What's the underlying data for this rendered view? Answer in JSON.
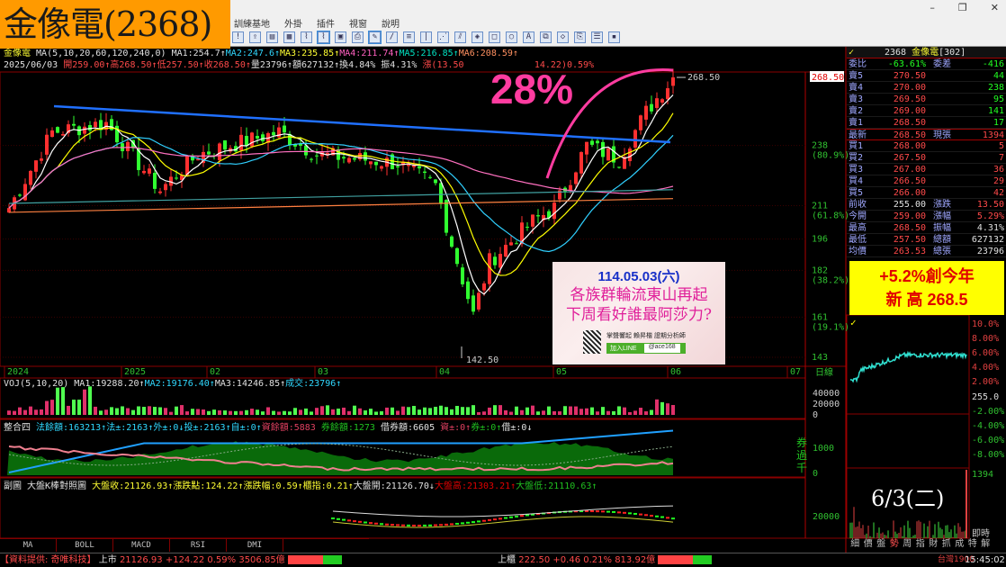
{
  "logo": "金像電(2368)",
  "menu": [
    "訓練基地",
    "外掛",
    "插件",
    "視窗",
    "說明"
  ],
  "toolbar_icons": [
    "alert-icon",
    "export-icon",
    "layout1-icon",
    "layout2-icon",
    "chart1-icon",
    "chart2-icon",
    "chart3-icon",
    "print-icon",
    "draw-icon",
    "line-icon",
    "fib-icon",
    "vlines-icon",
    "fan-icon",
    "channel-icon",
    "pattern-icon",
    "rect-icon",
    "circle-icon",
    "text-icon",
    "copy-icon",
    "eraser-icon",
    "snapshot-icon",
    "colors-icon",
    "save-icon"
  ],
  "info1": {
    "name": "金像電",
    "ma": "MA(5,10,20,60,120,240,0)",
    "ma1": "MA1:254.7↑",
    "ma2": "MA2:247.6↑",
    "ma3": "MA3:235.85↑",
    "ma4": "MA4:211.74↑",
    "ma5": "MA5:216.85↑",
    "ma6": "MA6:208.59↑"
  },
  "info2": {
    "date": "2025/06/03",
    "open": "開259.00↑",
    "high": "高268.50↑",
    "low": "低257.50↑",
    "close": "收268.50↑",
    "vol": "量23796↑",
    "amt": "額627132↑",
    "turn": "換4.84%",
    "amp": "振4.31%",
    "chg": "漲(13.50",
    "chg2": "14.22)0.59%"
  },
  "annotation": "28%",
  "price_axis": [
    {
      "v": "238",
      "p": "(80.9%)"
    },
    {
      "v": "211",
      "p": "(61.8%)"
    },
    {
      "v": "196",
      "p": ""
    },
    {
      "v": "182",
      "p": "(38.2%)"
    },
    {
      "v": "161",
      "p": "(19.1%)"
    },
    {
      "v": "143",
      "p": ""
    }
  ],
  "last_price": "268.50",
  "high_label": "268.50",
  "low_label": "142.50",
  "date_axis": [
    "2024",
    "2025",
    "02",
    "03",
    "04",
    "05",
    "06",
    "07"
  ],
  "period": "日線",
  "price_keypoints": [
    [
      0,
      210
    ],
    [
      8,
      244
    ],
    [
      18,
      248
    ],
    [
      28,
      218
    ],
    [
      35,
      234
    ],
    [
      50,
      244
    ],
    [
      57,
      234
    ],
    [
      72,
      230
    ],
    [
      79,
      220
    ],
    [
      82,
      194
    ],
    [
      86,
      162
    ],
    [
      89,
      186
    ],
    [
      97,
      204
    ],
    [
      101,
      210
    ],
    [
      107,
      238
    ],
    [
      113,
      232
    ],
    [
      118,
      253
    ],
    [
      123,
      268.5
    ]
  ],
  "ad": {
    "date": "114.05.03(六)",
    "line1": "各族群輪流東山再起",
    "line2": "下周看好誰最阿莎力?",
    "footer": "掌聲響起 賴昇楷 證期分析師",
    "line_btn": "加入LINE",
    "line_id": "@ace168"
  },
  "voj": {
    "title": "VOJ(5,10,20)",
    "ma1": "MA1:19288.20↑",
    "ma2": "MA2:19176.40↑",
    "ma3": "MA3:14246.85↑",
    "vol": "成交:23796↑",
    "axis": [
      "40000",
      "20000",
      "0"
    ]
  },
  "chip": {
    "title": "整合四",
    "a": "法餘額:163213↑",
    "b": "法±:2163↑",
    "c": "外±:0↓",
    "d": "投±:2163↑",
    "e": "自±:0↑",
    "f": "資餘額:5883",
    "g": "券餘額:1273",
    "h": "借券額:6605",
    "i": "資±:0↑",
    "j": "券±:0↑",
    "k": "借±:0↓",
    "unit": "券過千",
    "axis": [
      "1000",
      "0"
    ]
  },
  "sub": {
    "title": "副圖",
    "name": "大盤K棒對照圖",
    "a": "大盤收:21126.93↑",
    "b": "漲跌點:124.22↑",
    "c": "漲跌幅:0.59↑",
    "d": "櫃指:0.21↑",
    "e": "大盤開:21126.70↓",
    "f": "大盤高:21303.21↑",
    "g": "大盤低:21110.63↑",
    "axis": "20000"
  },
  "tabs": [
    "MA",
    "BOLL",
    "MACD",
    "RSI",
    "DMI"
  ],
  "book": {
    "code": "2368",
    "name": "金像電",
    "suffix": "[302]",
    "ratio": {
      "l": "委比",
      "v": "-63.61%",
      "l2": "委差",
      "v2": "-416"
    },
    "asks": [
      {
        "l": "賣5",
        "p": "270.50",
        "q": "44"
      },
      {
        "l": "賣4",
        "p": "270.00",
        "q": "238"
      },
      {
        "l": "賣3",
        "p": "269.50",
        "q": "95"
      },
      {
        "l": "賣2",
        "p": "269.00",
        "q": "141"
      },
      {
        "l": "賣1",
        "p": "268.50",
        "q": "17"
      }
    ],
    "last": {
      "l": "最新",
      "p": "268.50",
      "l2": "現張",
      "q": "1394"
    },
    "bids": [
      {
        "l": "買1",
        "p": "268.00",
        "q": "5"
      },
      {
        "l": "買2",
        "p": "267.50",
        "q": "7"
      },
      {
        "l": "買3",
        "p": "267.00",
        "q": "36"
      },
      {
        "l": "買4",
        "p": "266.50",
        "q": "29"
      },
      {
        "l": "買5",
        "p": "266.00",
        "q": "42"
      }
    ],
    "stats": [
      {
        "l": "前收",
        "v": "255.00",
        "l2": "漲跌",
        "v2": "13.50"
      },
      {
        "l": "今開",
        "v": "259.00",
        "l2": "漲幅",
        "v2": "5.29%"
      },
      {
        "l": "最高",
        "v": "268.50",
        "l2": "振幅",
        "v2": "4.31%"
      },
      {
        "l": "最低",
        "v": "257.50",
        "l2": "總額",
        "v2": "627132"
      },
      {
        "l": "均價",
        "v": "263.53",
        "l2": "總張",
        "v2": "23796"
      }
    ]
  },
  "note": {
    "line1": "+5.2%創今年",
    "line2": "新 高 268.5"
  },
  "intraday": {
    "axis_up": [
      "10.0%",
      "8.00%",
      "6.00%",
      "4.00%",
      "2.00%"
    ],
    "ref": "255.0",
    "axis_dn": [
      "-2.00%",
      "-4.00%",
      "-6.00%",
      "-8.00%"
    ],
    "vol_max": "1394",
    "date": "6/3(二)",
    "realtime": "即時"
  },
  "right_tabs": [
    "細",
    "價",
    "盤",
    "勢",
    "周",
    "指",
    "財",
    "抓",
    "成",
    "特",
    "解"
  ],
  "status": {
    "source": "【資料提供: 奇唯科技】",
    "twse": "上市",
    "twse_v": "21126.93 +124.22 0.59% 3506.85億",
    "otc": "上櫃",
    "otc_v": "222.50 +0.46 0.21% 813.92億",
    "conn": "台灣1900",
    "time": "15:45:02"
  }
}
